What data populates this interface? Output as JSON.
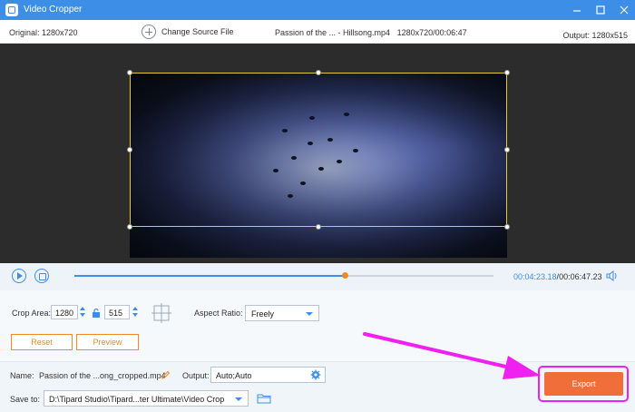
{
  "window": {
    "title": "Video Cropper",
    "controls": [
      "minimize",
      "maximize",
      "close"
    ]
  },
  "info_bar": {
    "original": "Original: 1280x720",
    "change_source": "Change Source File",
    "file_name": "Passion of the ... - Hillsong.mp4",
    "file_meta": "1280x720/00:06:47",
    "output": "Output: 1280x515"
  },
  "playback": {
    "current_time": "00:04:23.18",
    "separator": "/",
    "total_time": "00:06:47.23",
    "progress_fraction": 0.646,
    "icons": [
      "play-icon",
      "stop-icon",
      "volume-icon"
    ]
  },
  "crop": {
    "area_label": "Crop Area:",
    "width": "1280",
    "height": "515",
    "aspect_label": "Aspect Ratio:",
    "aspect_value": "Freely",
    "reset_label": "Reset",
    "preview_label": "Preview"
  },
  "output_settings": {
    "name_label": "Name:",
    "name_value": "Passion of the ...ong_cropped.mp4",
    "output_label": "Output:",
    "output_value": "Auto;Auto",
    "save_label": "Save to:",
    "save_path": "D:\\Tipard Studio\\Tipard...ter Ultimate\\Video Crop"
  },
  "export_label": "Export",
  "colors": {
    "title_bar": "#3d8ee6",
    "accent_blue": "#3d8ee6",
    "accent_orange": "#f08a24",
    "export_button": "#f06e3a",
    "highlight_magenta": "#f020f0"
  }
}
